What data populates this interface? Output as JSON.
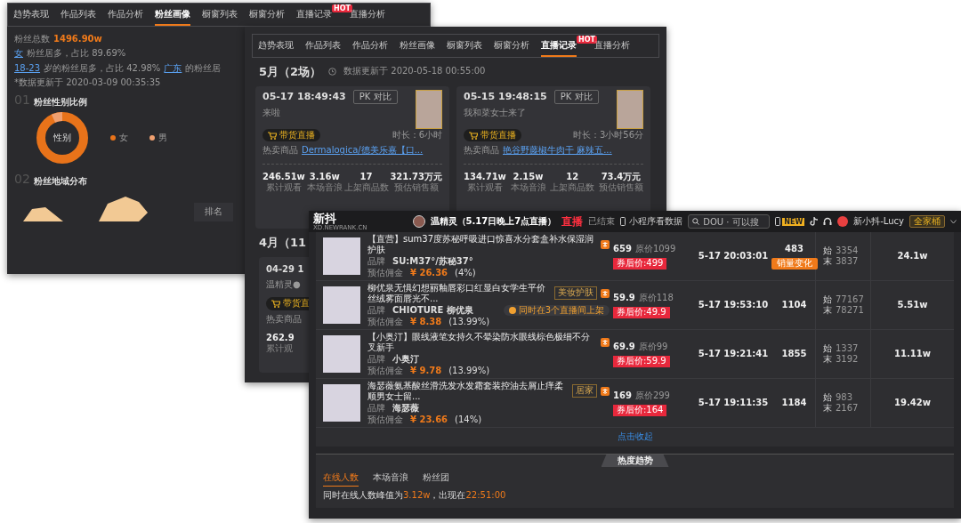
{
  "back_window": {
    "tabs": [
      {
        "label": "趋势表现",
        "selected": false
      },
      {
        "label": "作品列表",
        "selected": false
      },
      {
        "label": "作品分析",
        "selected": false
      },
      {
        "label": "粉丝画像",
        "selected": true
      },
      {
        "label": "橱窗列表",
        "selected": false
      },
      {
        "label": "橱窗分析",
        "selected": false
      },
      {
        "label": "直播记录",
        "selected": false,
        "badge": "HOT"
      },
      {
        "label": "直播分析",
        "selected": false
      }
    ],
    "total_label": "粉丝总数",
    "total_value": "1496.90w",
    "stats": [
      {
        "highlight": "女",
        "text": "粉丝居多，占比 89.69%"
      },
      {
        "highlight": "18-23",
        "text": "岁的粉丝居多，占比 42.98%"
      },
      {
        "highlight": "广东",
        "text": "的粉丝居"
      }
    ],
    "updated": "*数据更新于 2020-03-09 00:35:35",
    "sections": [
      {
        "number": "01",
        "title": "粉丝性别比例"
      },
      {
        "number": "02",
        "title": "粉丝地域分布"
      }
    ],
    "donut_center": "性别",
    "legend": [
      {
        "label": "女",
        "color": "#e8731a"
      },
      {
        "label": "男",
        "color": "#f0a070"
      }
    ],
    "table_header": "排名"
  },
  "middle_window": {
    "tabs": [
      {
        "label": "趋势表现",
        "selected": false
      },
      {
        "label": "作品列表",
        "selected": false
      },
      {
        "label": "作品分析",
        "selected": false
      },
      {
        "label": "粉丝画像",
        "selected": false
      },
      {
        "label": "橱窗列表",
        "selected": false
      },
      {
        "label": "橱窗分析",
        "selected": false
      },
      {
        "label": "直播记录",
        "selected": true,
        "badge": "HOT"
      },
      {
        "label": "直播分析",
        "selected": false
      }
    ],
    "month_heading": "5月（2场）",
    "updated": "数据更新于 2020-05-18 00:55:00",
    "sessions": [
      {
        "time": "05-17 18:49:43",
        "compare": "PK 对比",
        "title": "来啦",
        "tag": "带货直播",
        "duration": "时长：6小时",
        "hot_label": "热卖商品",
        "hot_product": "Dermalogica/德美乐嘉【口...",
        "stats": [
          {
            "value": "246.51w",
            "label": "累计观看"
          },
          {
            "value": "3.16w",
            "label": "本场音浪"
          },
          {
            "value": "17",
            "label": "上架商品数"
          },
          {
            "value": "321.73万元",
            "label": "预估销售额"
          }
        ]
      },
      {
        "time": "05-15 19:48:15",
        "compare": "PK 对比",
        "title": "我和菜女士来了",
        "tag": "带货直播",
        "duration": "时长：3小时56分",
        "hot_label": "热卖商品",
        "hot_product": "艳谷野藤椒牛肉干 麻辣五...",
        "stats": [
          {
            "value": "134.71w",
            "label": "累计观看"
          },
          {
            "value": "2.15w",
            "label": "本场音浪"
          },
          {
            "value": "12",
            "label": "上架商品数"
          },
          {
            "value": "73.4万元",
            "label": "预估销售额"
          }
        ]
      }
    ],
    "april_heading": "4月（11",
    "april_session": {
      "time": "04-29 1",
      "title": "温精灵●",
      "tag": "带货直",
      "hot_label": "热卖商品",
      "stat_value": "262.9",
      "stat_label": "累计观"
    }
  },
  "front_window": {
    "logo": "新抖",
    "logo_sub": "XD.NEWRANK.CN",
    "streamer": "温精灵（5.17日晚上7点直播）",
    "live_label": "直播",
    "live_status": "已结束",
    "mini_program": "小程序看数据",
    "search": {
      "placeholder": "DOU · 可以搜"
    },
    "new_badge": "NEW",
    "user": "新小抖-Lucy",
    "plan": "全家桶",
    "products": [
      {
        "title": "【直营】sum37度苏秘呼吸进口惊喜水分套盒补水保湿润护肤",
        "brand_label": "品牌",
        "brand": "SU:M37°/苏秘37°",
        "commission_label": "预估佣金",
        "commission": "¥ 26.36",
        "rate": "(4%)",
        "price": "659",
        "original_price": "原价1099",
        "coupon": "券后价:499",
        "time": "5-17 20:03:01",
        "sales": "483",
        "sales_button": "销量变化",
        "start_label": "始",
        "start": "3354",
        "end_label": "末",
        "end": "3837",
        "volume": "24.1w"
      },
      {
        "title": "柳优泉无惧幻想丽釉唇彩口红显白女学生平价丝绒雾面唇光不...",
        "tag": "美妆护肤",
        "brand_label": "品牌",
        "brand": "CHIOTURE 柳优泉",
        "commission_label": "预估佣金",
        "commission": "¥ 8.38",
        "rate": "(13.99%)",
        "multi_badge": "同时在3个直播间上架",
        "price": "59.9",
        "original_price": "原价118",
        "coupon": "券后价:49.9",
        "time": "5-17 19:53:10",
        "sales": "1104",
        "start_label": "始",
        "start": "77167",
        "end_label": "末",
        "end": "78271",
        "volume": "5.51w"
      },
      {
        "title": "【小奥汀】眼线液笔女持久不晕染防水眼线棕色极细不分叉新手",
        "brand_label": "品牌",
        "brand": "小奥汀",
        "commission_label": "预估佣金",
        "commission": "¥ 9.78",
        "rate": "(13.99%)",
        "price": "69.9",
        "original_price": "原价99",
        "coupon": "券后价:59.9",
        "time": "5-17 19:21:41",
        "sales": "1855",
        "start_label": "始",
        "start": "1337",
        "end_label": "末",
        "end": "3192",
        "volume": "11.11w"
      },
      {
        "title": "海瑟薇氨基酸丝滑洗发水发霜套装控油去屑止痒柔顺男女士留...",
        "tag": "居家",
        "brand_label": "品牌",
        "brand": "海瑟薇",
        "commission_label": "预估佣金",
        "commission": "¥ 23.66",
        "rate": "(14%)",
        "price": "169",
        "original_price": "原价299",
        "coupon": "券后价:164",
        "time": "5-17 19:11:35",
        "sales": "1184",
        "start_label": "始",
        "start": "983",
        "end_label": "末",
        "end": "2167",
        "volume": "19.42w"
      }
    ],
    "collapse": "点击收起",
    "trend": {
      "title": "热度趋势",
      "tabs": [
        {
          "label": "在线人数",
          "selected": true
        },
        {
          "label": "本场音浪",
          "selected": false
        },
        {
          "label": "粉丝团",
          "selected": false
        }
      ],
      "summary": [
        {
          "text": "同时在线人数峰值为",
          "highlight": false
        },
        {
          "text": "3.12w",
          "highlight": true
        },
        {
          "text": "，出现在",
          "highlight": false
        },
        {
          "text": "22:51:00",
          "highlight": true
        }
      ]
    }
  }
}
